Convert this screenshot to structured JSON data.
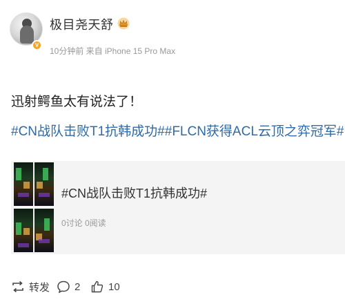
{
  "author": {
    "name": "极目尧天舒",
    "meta": "10分钟前 来自 iPhone 15 Pro Max",
    "vip_icon": "crown-badge-icon",
    "avatar_badge_color": "#f5a623"
  },
  "post": {
    "text": "迅射鳄鱼太有说法了！",
    "topics": "#CN战队击败T1抗韩成功##FLCN获得ACL云顶之弈冠军#",
    "topic_color": "#2c6aa8"
  },
  "card": {
    "title": "#CN战队击败T1抗韩成功#",
    "stats": "0讨论 0阅读"
  },
  "actions": {
    "repost_label": "转发",
    "comment_count": "2",
    "like_count": "10"
  }
}
